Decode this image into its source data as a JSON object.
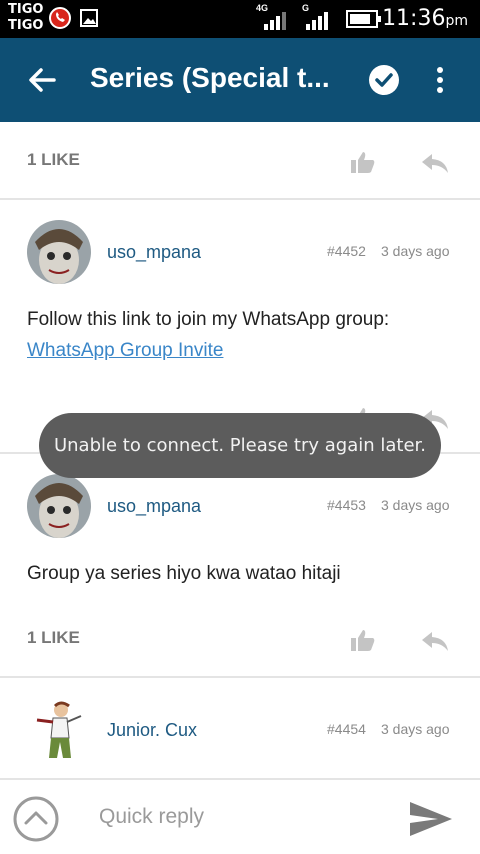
{
  "statusbar": {
    "carrier_line1": "TIGO",
    "carrier_line2": "TIGO",
    "net1": "4G",
    "net2": "G",
    "time": "11:36",
    "ampm": "pm"
  },
  "appbar": {
    "title": "Series (Special t...",
    "icons": [
      "back-arrow-icon",
      "check-circle-icon",
      "overflow-menu-icon"
    ]
  },
  "top_like_bar": {
    "like_count": "1 LIKE"
  },
  "posts": [
    {
      "username": "uso_mpana",
      "post_id": "#4452",
      "time_ago": "3 days ago",
      "text": "Follow this link to join my WhatsApp group:",
      "link_text": "WhatsApp Group Invite"
    },
    {
      "username": "uso_mpana",
      "post_id": "#4453",
      "time_ago": "3 days ago",
      "text": "Group ya series hiyo kwa watao hitaji",
      "like_count": "1 LIKE"
    },
    {
      "username": "Junior. Cux",
      "post_id": "#4454",
      "time_ago": "3 days ago"
    }
  ],
  "toast": {
    "message": "Unable to connect. Please try again later."
  },
  "reply_bar": {
    "placeholder": "Quick reply"
  },
  "colors": {
    "appbar": "#0e4f74",
    "link": "#3a86c8",
    "username": "#1e5a82",
    "toast": "#5c5c5c"
  }
}
